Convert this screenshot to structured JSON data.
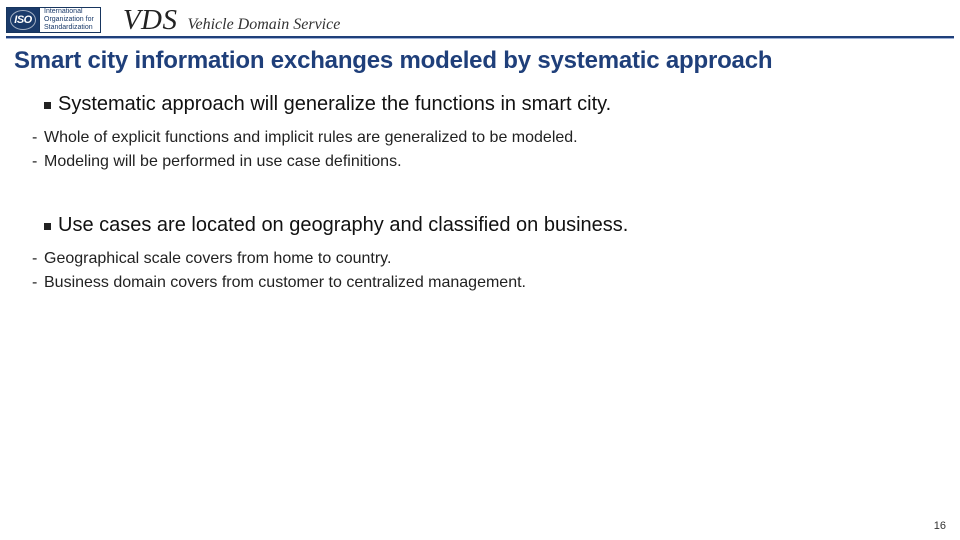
{
  "header": {
    "iso_mark": "ISO",
    "iso_line1": "International",
    "iso_line2": "Organization for",
    "iso_line3": "Standardization",
    "vds_abbrev": "VDS",
    "vds_full": "Vehicle Domain Service"
  },
  "title": "Smart city information exchanges modeled by systematic approach",
  "sections": [
    {
      "heading": "Systematic approach will generalize the functions in smart city.",
      "items": [
        "Whole of explicit functions and implicit rules are generalized to be modeled.",
        "Modeling will be performed in use case definitions."
      ]
    },
    {
      "heading": "Use cases are located on geography and classified on business.",
      "items": [
        "Geographical scale covers from home to country.",
        "Business domain covers from customer to centralized management."
      ]
    }
  ],
  "page_number": "16"
}
